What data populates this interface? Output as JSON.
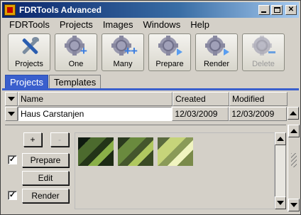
{
  "window": {
    "title": "FDRTools Advanced"
  },
  "menu": [
    "FDRTools",
    "Projects",
    "Images",
    "Windows",
    "Help"
  ],
  "toolbar": [
    {
      "label": "Projects",
      "icon": "tools-icon",
      "enabled": true
    },
    {
      "label": "One",
      "icon": "gear-add-one-icon",
      "enabled": true
    },
    {
      "label": "Many",
      "icon": "gear-add-many-icon",
      "enabled": true
    },
    {
      "label": "Prepare",
      "icon": "gear-prepare-icon",
      "enabled": true
    },
    {
      "label": "Render",
      "icon": "gear-render-icon",
      "enabled": true
    },
    {
      "label": "Delete",
      "icon": "gear-delete-icon",
      "enabled": false
    }
  ],
  "tabs": [
    {
      "label": "Projects",
      "active": true
    },
    {
      "label": "Templates",
      "active": false
    }
  ],
  "table": {
    "headers": {
      "name": "Name",
      "created": "Created",
      "modified": "Modified"
    },
    "row": {
      "name": "Haus Carstanjen",
      "created": "12/03/2009",
      "modified": "12/03/2009"
    }
  },
  "panel": {
    "add_label": "+",
    "remove_label": "-",
    "prepare_checked": true,
    "prepare_label": "Prepare",
    "edit_label": "Edit",
    "render_checked": true,
    "render_label": "Render",
    "check_mark": "✓"
  },
  "colors": {
    "active_tab": "#3a5fcd",
    "title_bar": "#0a246a"
  }
}
